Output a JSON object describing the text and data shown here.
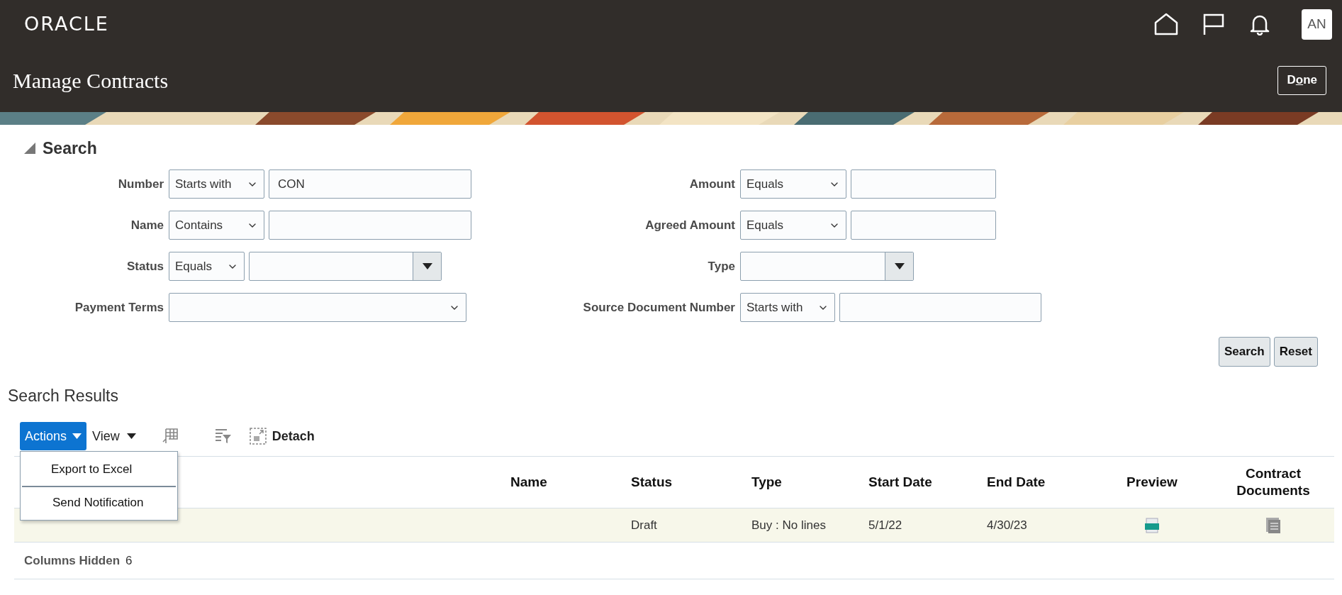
{
  "header": {
    "logo": "ORACLE",
    "avatar": "AN"
  },
  "page": {
    "title": "Manage Contracts",
    "done_button": {
      "before": "D",
      "access_key": "o",
      "after": "ne"
    }
  },
  "search": {
    "title": "Search",
    "expanded": true,
    "left_fields": [
      {
        "label": "Number",
        "kind": "operator_text",
        "operator": "Starts with",
        "value": "CON"
      },
      {
        "label": "Name",
        "kind": "operator_text",
        "operator": "Contains"
      },
      {
        "label": "Status",
        "kind": "operator_lov",
        "operator": "Equals"
      },
      {
        "label": "Payment Terms",
        "kind": "select"
      }
    ],
    "right_fields": [
      {
        "label": "Amount",
        "kind": "operator_text",
        "operator": "Equals"
      },
      {
        "label": "Agreed Amount",
        "kind": "operator_text",
        "operator": "Equals"
      },
      {
        "label": "Type",
        "kind": "lov"
      },
      {
        "label": "Source Document Number",
        "kind": "operator_text",
        "operator": "Starts with"
      }
    ],
    "buttons": [
      "Search",
      "Reset"
    ]
  },
  "results": {
    "title": "Search Results",
    "toolbar": {
      "actions": "Actions",
      "view": "View",
      "detach": "Detach"
    },
    "actions_menu": {
      "expanded": true,
      "items": [
        "Export to Excel",
        "Send Notification"
      ]
    },
    "columns": [
      "Name",
      "Status",
      "Type",
      "Start Date",
      "End Date",
      "Preview",
      "Contract Documents"
    ],
    "rows": [
      {
        "status": "Draft",
        "type": "Buy : No lines",
        "start_date": "5/1/22",
        "end_date": "4/30/23",
        "selected": true
      }
    ],
    "columns_hidden": {
      "label": "Columns Hidden",
      "count": "6"
    }
  }
}
